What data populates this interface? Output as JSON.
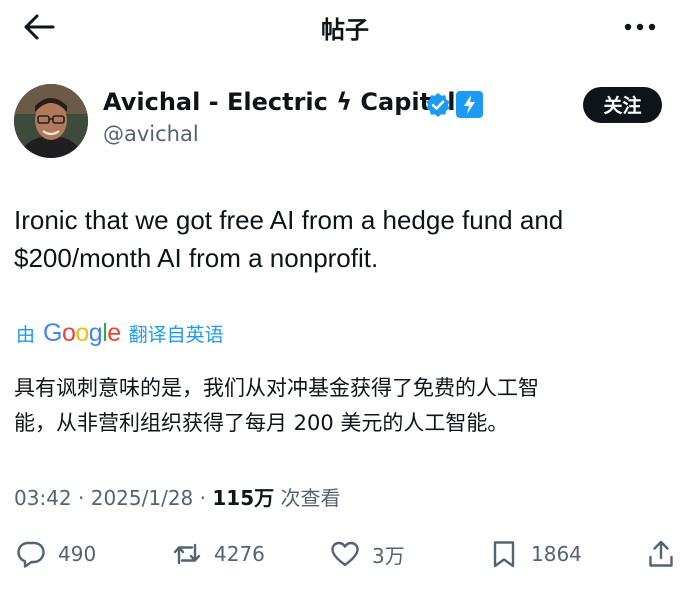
{
  "header": {
    "title": "帖子"
  },
  "author": {
    "name": "Avichal - Electric ϟ Capital",
    "handle": "@avichal",
    "follow_label": "关注"
  },
  "tweet": {
    "text_line1": "Ironic that we got free AI from a hedge fund and",
    "text_line2": "$200/month AI from a nonprofit.",
    "translate_prefix": "由",
    "translate_brand": "Google",
    "translate_suffix": "翻译自英语",
    "translated_line1": "具有讽刺意味的是，我们从对冲基金获得了免费的人工智",
    "translated_line2": "能，从非营利组织获得了每月 200 美元的人工智能。"
  },
  "meta": {
    "time": "03:42",
    "sep1": "·",
    "date": "2025/1/28",
    "sep2": "·",
    "views": "115万",
    "views_label": "次查看"
  },
  "actions": {
    "replies": "490",
    "reposts": "4276",
    "likes": "3万",
    "bookmarks": "1864"
  },
  "icons": [
    "back-arrow-icon",
    "more-icon",
    "verified-icon",
    "lightning-badge-icon",
    "reply-icon",
    "repost-icon",
    "like-icon",
    "bookmark-icon",
    "share-icon"
  ],
  "colors": {
    "accent": "#1d9bf0",
    "text": "#0f1419",
    "secondary": "#536471",
    "button_bg": "#0f1419"
  }
}
